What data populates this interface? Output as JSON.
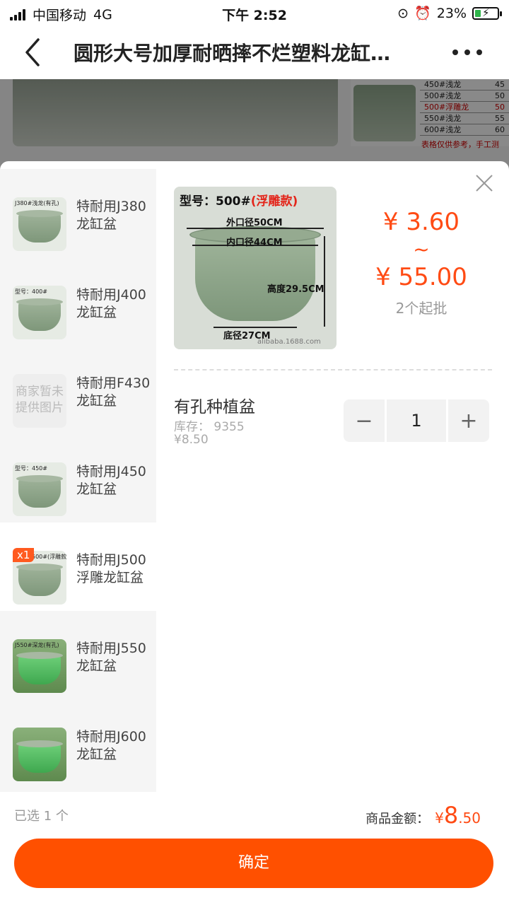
{
  "status_bar": {
    "carrier": "中国移动",
    "network": "4G",
    "time": "下午 2:52",
    "battery": "23%"
  },
  "nav": {
    "title": "圆形大号加厚耐晒摔不烂塑料龙缸…"
  },
  "background": {
    "table_rows": [
      {
        "label": "450#浅龙",
        "value": "45",
        "highlight": false
      },
      {
        "label": "500#浅龙",
        "value": "50",
        "highlight": false
      },
      {
        "label": "500#浮雕龙",
        "value": "50",
        "highlight": true
      },
      {
        "label": "550#浅龙",
        "value": "55",
        "highlight": false
      },
      {
        "label": "600#浅龙",
        "value": "60",
        "highlight": false
      }
    ],
    "note": "表格仅供参考，手工测"
  },
  "sku_list": [
    {
      "name": "特耐用J380龙缸盆",
      "caption": "J380#浅龙(有孔)",
      "thumb": "pot",
      "active": false,
      "badge": ""
    },
    {
      "name": "特耐用J400龙缸盆",
      "caption": "型号：400#",
      "thumb": "pot",
      "active": false,
      "badge": ""
    },
    {
      "name": "特耐用F430龙缸盆",
      "caption": "",
      "thumb": "noimg",
      "noimg_text": "商家暂未提供图片",
      "active": false,
      "badge": ""
    },
    {
      "name": "特耐用J450龙缸盆",
      "caption": "型号：450#",
      "thumb": "pot",
      "active": false,
      "badge": ""
    },
    {
      "name": "特耐用J500浮雕龙缸盆",
      "caption": "型号：500#(浮雕款)",
      "thumb": "pot",
      "active": true,
      "badge": "x1"
    },
    {
      "name": "特耐用J550龙缸盆",
      "caption": "J550#深龙(有孔)",
      "thumb": "grass",
      "active": false,
      "badge": ""
    },
    {
      "name": "特耐用J600龙缸盆",
      "caption": "",
      "thumb": "grass",
      "active": false,
      "badge": ""
    }
  ],
  "product": {
    "image_title": "型号：500#",
    "image_title_red": "(浮雕款)",
    "outer_diameter": "外口径50CM",
    "inner_diameter": "内口径44CM",
    "height": "高度29.5CM",
    "bottom_diameter": "底径27CM",
    "watermark": "alibaba.1688.com",
    "price_low": "¥ 3.60",
    "price_sep": "~",
    "price_high": "¥ 55.00",
    "moq": "2个起批"
  },
  "option": {
    "name": "有孔种植盆",
    "stock": "库存：  9355",
    "price": "¥8.50",
    "quantity": "1",
    "minus": "−",
    "plus": "+"
  },
  "footer": {
    "selected": "已选 1 个",
    "total_label": "商品金额：",
    "total_yen": "¥",
    "total_int": "8",
    "total_dec": ".50",
    "confirm": "确定"
  },
  "colors": {
    "accent": "#ff5000",
    "price": "#ff4b14",
    "sidebar_bg": "#f5f5f5"
  }
}
